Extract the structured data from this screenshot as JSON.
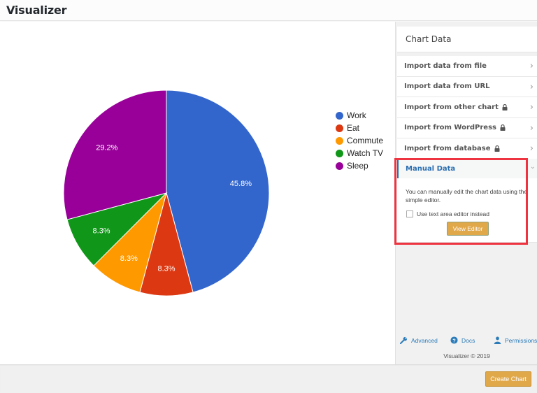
{
  "app": {
    "title": "Visualizer"
  },
  "chart_data": {
    "type": "pie",
    "title": "",
    "categories": [
      "Work",
      "Eat",
      "Commute",
      "Watch TV",
      "Sleep"
    ],
    "values": [
      11,
      2,
      2,
      2,
      7
    ],
    "labels": [
      "45.8%",
      "8.3%",
      "8.3%",
      "8.3%",
      "29.2%"
    ],
    "colors": [
      "#3366cc",
      "#dc3912",
      "#ff9900",
      "#109618",
      "#990099"
    ],
    "legend": "right"
  },
  "sidebar": {
    "heading": "Chart Data",
    "items": [
      {
        "label": "Import data from file",
        "locked": false
      },
      {
        "label": "Import data from URL",
        "locked": false
      },
      {
        "label": "Import from other chart",
        "locked": true
      },
      {
        "label": "Import from WordPress",
        "locked": true
      },
      {
        "label": "Import from database",
        "locked": true
      }
    ],
    "manual": {
      "label": "Manual Data",
      "description": "You can manually edit the chart data using the simple editor.",
      "checkbox_label": "Use text area editor instead",
      "checkbox_checked": false,
      "button_label": "View Editor"
    },
    "links": [
      {
        "label": "Advanced",
        "icon": "wrench-icon"
      },
      {
        "label": "Docs",
        "icon": "help-icon"
      },
      {
        "label": "Permissions",
        "icon": "user-icon"
      }
    ],
    "copyright": "Visualizer © 2019"
  },
  "footer": {
    "create_label": "Create Chart"
  },
  "colors": {
    "accent_button": "#e1a84a",
    "highlight": "#ee3440",
    "link": "#2b7bb9"
  }
}
